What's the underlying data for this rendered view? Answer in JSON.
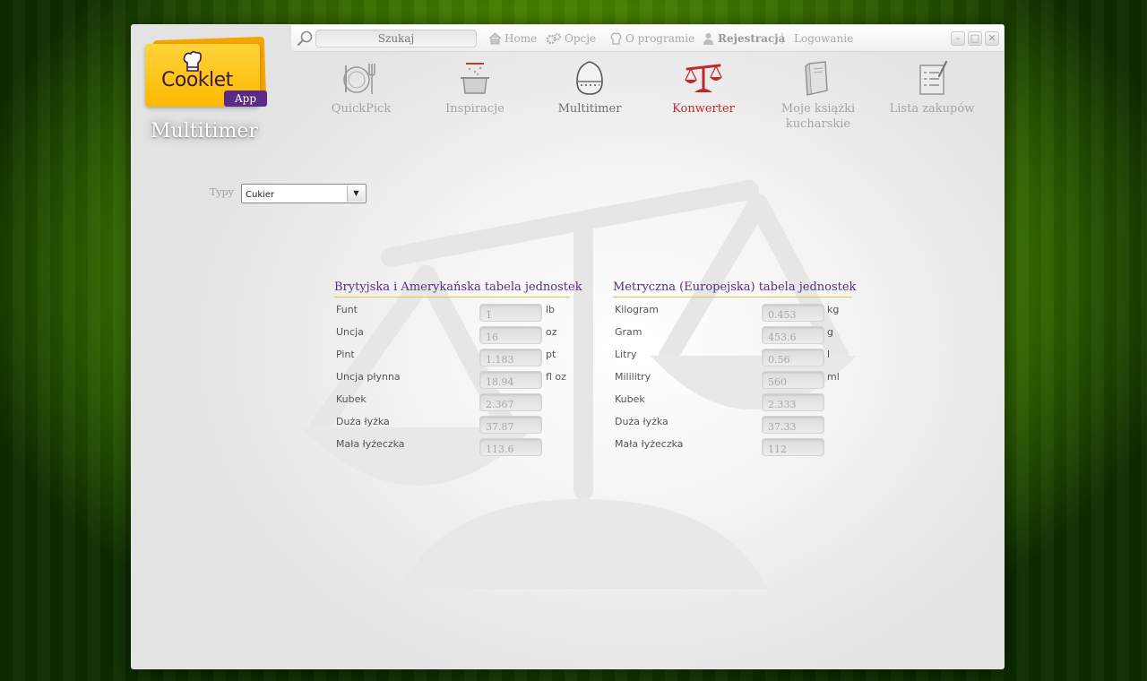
{
  "topbar": {
    "search_placeholder": "Szukaj",
    "links": [
      {
        "label": "Home"
      },
      {
        "label": "Opcje"
      },
      {
        "label": "O programie"
      },
      {
        "label": "Rejestracja"
      },
      {
        "label": "Logowanie"
      }
    ],
    "separator": "|"
  },
  "logo": {
    "brand": "Cooklet",
    "sub": "App"
  },
  "page_title": "Multitimer",
  "nav": [
    {
      "label": "QuickPick",
      "icon": "plate-fork-knife-icon"
    },
    {
      "label": "Inspiracje",
      "icon": "cooking-pot-icon"
    },
    {
      "label": "Multitimer",
      "icon": "egg-timer-icon"
    },
    {
      "label": "Konwerter",
      "icon": "scales-icon",
      "active": true
    },
    {
      "label": "Moje książki kucharskie",
      "icon": "book-icon"
    },
    {
      "label": "Lista zakupów",
      "icon": "checklist-icon"
    }
  ],
  "types": {
    "label": "Typy",
    "selected": "Cukier"
  },
  "tables": {
    "imperial": {
      "title": "Brytyjska i Amerykańska tabela jednostek",
      "rows": [
        {
          "label": "Funt",
          "value": "1",
          "unit": "lb"
        },
        {
          "label": "Uncja",
          "value": "16",
          "unit": "oz"
        },
        {
          "label": "Pint",
          "value": "1.183",
          "unit": "pt"
        },
        {
          "label": "Uncja płynna",
          "value": "18.94",
          "unit": "fl oz"
        },
        {
          "label": "Kubek",
          "value": "2.367",
          "unit": ""
        },
        {
          "label": "Duża łyżka",
          "value": "37.87",
          "unit": ""
        },
        {
          "label": "Mała łyżeczka",
          "value": "113.6",
          "unit": ""
        }
      ]
    },
    "metric": {
      "title": "Metryczna (Europejska) tabela jednostek",
      "rows": [
        {
          "label": "Kilogram",
          "value": "0.453",
          "unit": "kg"
        },
        {
          "label": "Gram",
          "value": "453.6",
          "unit": "g"
        },
        {
          "label": "Litry",
          "value": "0.56",
          "unit": "l"
        },
        {
          "label": "Mililitry",
          "value": "560",
          "unit": "ml"
        },
        {
          "label": "Kubek",
          "value": "2.333",
          "unit": ""
        },
        {
          "label": "Duża łyżka",
          "value": "37.33",
          "unit": ""
        },
        {
          "label": "Mała łyżeczka",
          "value": "112",
          "unit": ""
        }
      ]
    }
  },
  "colors": {
    "accent_purple": "#5b2a86",
    "active_red": "#c1272d",
    "logo_yellow": "#fbb800",
    "underline_gold": "#e7c442"
  }
}
